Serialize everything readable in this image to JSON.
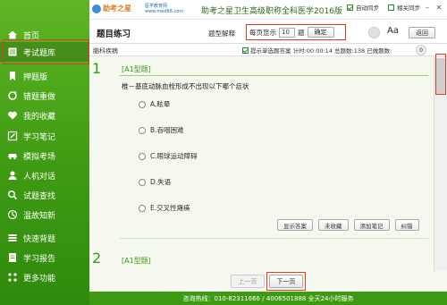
{
  "colors": {
    "accent": "#3f9a13",
    "highlight": "#e63a1e"
  },
  "sidebar": {
    "items": [
      {
        "label": "首页",
        "icon": "home-icon"
      },
      {
        "label": "考试题库",
        "icon": "book-icon"
      },
      {
        "label": "押题版",
        "icon": "bookmark-icon"
      },
      {
        "label": "错题重做",
        "icon": "redo-icon"
      },
      {
        "label": "我的收藏",
        "icon": "heart-icon"
      },
      {
        "label": "学习笔记",
        "icon": "pencil-icon"
      },
      {
        "label": "模拟考场",
        "icon": "car-icon"
      },
      {
        "label": "人机对话",
        "icon": "chat-icon"
      },
      {
        "label": "试题查找",
        "icon": "search-icon"
      },
      {
        "label": "温故知新",
        "icon": "refresh-icon"
      },
      {
        "label": "快速背题",
        "icon": "stack-icon"
      },
      {
        "label": "学习报告",
        "icon": "report-icon"
      },
      {
        "label": "更多功能",
        "icon": "grid-icon"
      }
    ]
  },
  "titlebar": {
    "logo1": "助考之星",
    "logo2_line1": "医学教育网",
    "logo2_line2": "www.med66.com",
    "title": "助考之星卫生高级职称全科医学2016版",
    "auto_sync": "自动同步",
    "sync": "相关同步"
  },
  "toolbar": {
    "page_title": "题目练习",
    "mode": "题型解释",
    "per_page_label": "每页显示",
    "per_page_value": "10",
    "per_page_unit": "题",
    "confirm": "确定",
    "font_label": "Aa",
    "back": "返回"
  },
  "subbar": {
    "category": "脑科疾病",
    "hint": "提示单选题答案 计时:00:00:14 总题数:138 已做题数:",
    "done_count": "0"
  },
  "questions": [
    {
      "number": "1",
      "type": "[A1型题]",
      "text": "椎－基底动脉血栓形成不出现以下哪个症状",
      "options": [
        "A.眩晕",
        "B.吞咽困难",
        "C.眼球运动障碍",
        "D.失语",
        "E.交叉性瘫痪"
      ]
    },
    {
      "number": "2",
      "type": "[A1型题]"
    }
  ],
  "actions": [
    "显示答案",
    "未收藏",
    "添加笔记",
    "纠错"
  ],
  "pager": {
    "prev": "上一页",
    "next": "下一页"
  },
  "footer": "咨询热线：010-82311666 / 4006501888  全天24小时服务"
}
